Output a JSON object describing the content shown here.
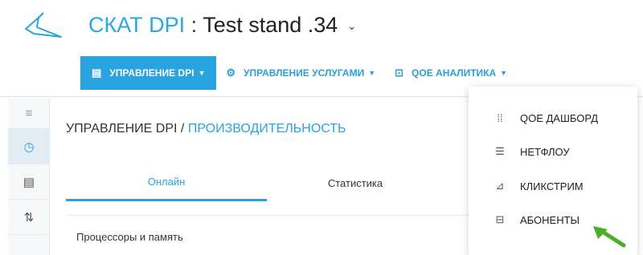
{
  "header": {
    "brand_accent": "СКАТ DPI",
    "separator": ":",
    "stand_name": "Test stand .34",
    "caret": "⌄"
  },
  "topnav": {
    "items": [
      {
        "label": "УПРАВЛЕНИЕ DPI",
        "icon": "grid-icon",
        "active": true
      },
      {
        "label": "УПРАВЛЕНИЕ УСЛУГАМИ",
        "icon": "gears-icon",
        "active": false
      },
      {
        "label": "QOE АНАЛИТИКА",
        "icon": "chart-box-icon",
        "active": false
      }
    ]
  },
  "sidebar": {
    "items": [
      {
        "icon": "hamburger-icon"
      },
      {
        "icon": "dashboard-gauge-icon",
        "active": true
      },
      {
        "icon": "table-icon"
      },
      {
        "icon": "sort-icon"
      }
    ]
  },
  "breadcrumb": {
    "root": "УПРАВЛЕНИЕ DPI",
    "slash": "/",
    "current": "ПРОИЗВОДИТЕЛЬНОСТЬ"
  },
  "tabs": {
    "online": "Онлайн",
    "statistics": "Статистика"
  },
  "section": {
    "title": "Процессоры и память"
  },
  "dropdown": {
    "items": [
      {
        "label": "QOE ДАШБОРД",
        "icon": "dotted-grid-icon"
      },
      {
        "label": "НЕТФЛОУ",
        "icon": "list-icon"
      },
      {
        "label": "КЛИКСТРИМ",
        "icon": "clickstream-chart-icon"
      },
      {
        "label": "АБОНЕНТЫ",
        "icon": "subscriber-list-icon"
      }
    ]
  },
  "colors": {
    "accent": "#2aa4e0",
    "pointer_arrow": "#4caf2a"
  }
}
